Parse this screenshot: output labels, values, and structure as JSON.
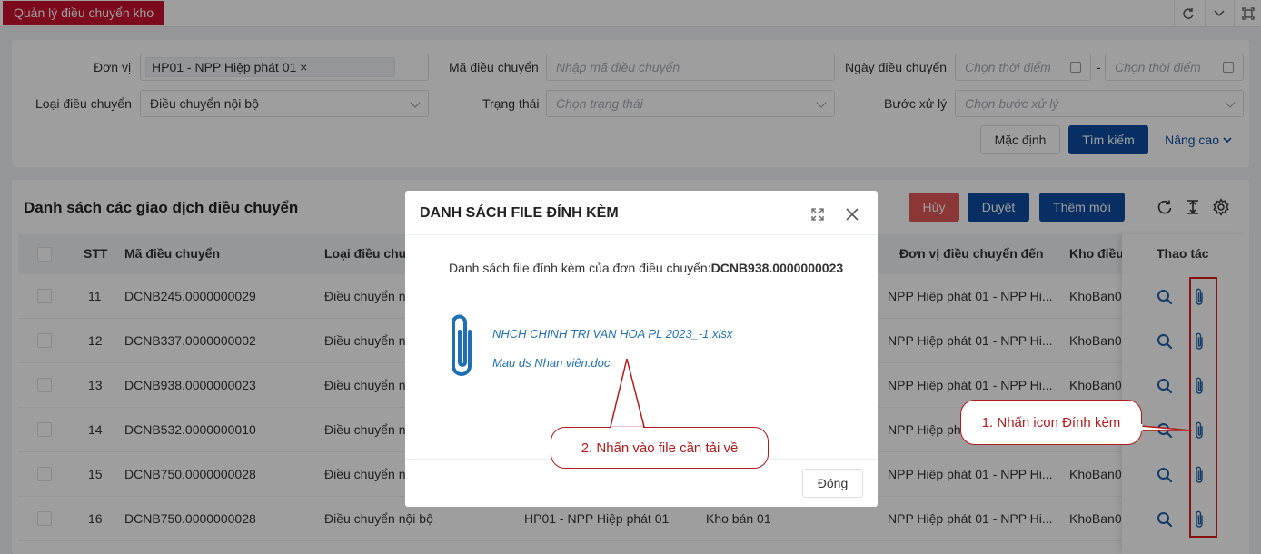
{
  "topbar": {
    "tab_label": "Quản lý điều chuyển kho"
  },
  "filter": {
    "don_vi_label": "Đơn vị",
    "don_vi_chip": "HP01 - NPP Hiệp phát 01",
    "ma_label": "Mã điều chuyển",
    "ma_placeholder": "Nhập mã điều chuyển",
    "ngay_label": "Ngày điều chuyển",
    "ngay_from_placeholder": "Chọn thời điểm",
    "ngay_sep": "-",
    "ngay_to_placeholder": "Chọn thời điểm",
    "loai_label": "Loại điều chuyển",
    "loai_value": "Điều chuyển nội bộ",
    "trang_thai_label": "Trạng thái",
    "trang_thai_placeholder": "Chọn trạng thái",
    "buoc_label": "Bước xử lý",
    "buoc_placeholder": "Chọn bước xử lý",
    "btn_default": "Mặc định",
    "btn_search": "Tìm kiếm",
    "btn_advanced": "Nâng cao"
  },
  "list": {
    "title": "Danh sách các giao dịch điều chuyển",
    "btn_cancel": "Hủy",
    "btn_approve": "Duyệt",
    "btn_add": "Thêm mới",
    "columns": [
      "STT",
      "Mã điều chuyển",
      "Loại điều chu",
      "Đơn vị điều chuyển đến",
      "Kho điều",
      "Thao tác"
    ],
    "rows": [
      {
        "stt": "11",
        "ma": "DCNB245.0000000029",
        "loai": "Điều chuyển n",
        "dv_from": "",
        "kho_from": "",
        "dv_den": "NPP Hiệp phát 01 - NPP Hi...",
        "kho": "KhoBan0"
      },
      {
        "stt": "12",
        "ma": "DCNB337.0000000002",
        "loai": "Điều chuyển n",
        "dv_from": "",
        "kho_from": "",
        "dv_den": "NPP Hiệp phát 01 - NPP Hi...",
        "kho": "KhoBan0"
      },
      {
        "stt": "13",
        "ma": "DCNB938.0000000023",
        "loai": "Điều chuyển n",
        "dv_from": "",
        "kho_from": "",
        "dv_den": "NPP Hiệp phát 01 - NPP Hi...",
        "kho": "KhoBan0"
      },
      {
        "stt": "14",
        "ma": "DCNB532.0000000010",
        "loai": "Điều chuyển n",
        "dv_from": "",
        "kho_from": "",
        "dv_den": "NPP Hiệp phát 01 - NPP Hi...",
        "kho": "KhoBan0"
      },
      {
        "stt": "15",
        "ma": "DCNB750.0000000028",
        "loai": "Điều chuyển n",
        "dv_from": "",
        "kho_from": "",
        "dv_den": "NPP Hiệp phát 01 - NPP Hi...",
        "kho": "KhoBan0"
      },
      {
        "stt": "16",
        "ma": "DCNB750.0000000028",
        "loai": "Điều chuyển nội bộ",
        "dv_from": "HP01 - NPP Hiệp phát 01",
        "kho_from": "Kho bán 01",
        "dv_den": "NPP Hiệp phát 01 - NPP Hi...",
        "kho": "KhoBan0"
      }
    ]
  },
  "modal": {
    "title": "DANH SÁCH FILE ĐÍNH KÈM",
    "desc_prefix": "Danh sách file đính kèm của đơn điều chuyển:",
    "desc_code": "DCNB938.0000000023",
    "files": [
      "NHCH CHINH TRI VAN HOA PL 2023_-1.xlsx",
      "Mau ds Nhan viên.doc"
    ],
    "close_button": "Đóng"
  },
  "annotations": {
    "callout1": "1. Nhấn icon Đính kèm",
    "callout2": "2. Nhấn vào file cần tải về",
    "accent_color": "#b01a1a"
  }
}
